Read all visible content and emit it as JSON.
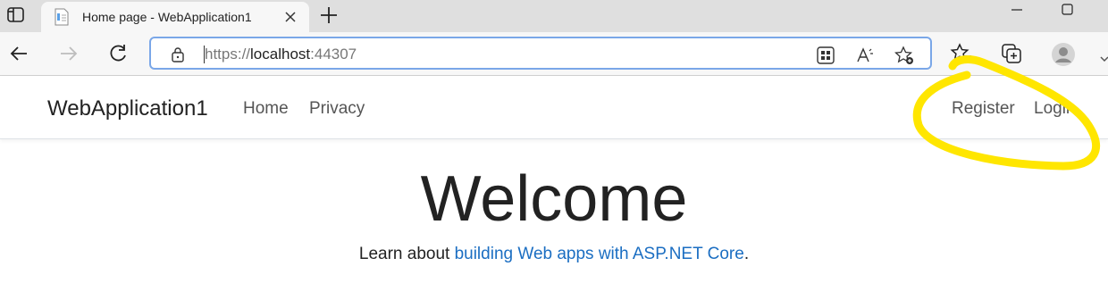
{
  "browser": {
    "tab": {
      "title": "Home page - WebApplication1"
    },
    "address_bar": {
      "scheme": "https://",
      "host": "localhost",
      "port": ":44307"
    }
  },
  "site": {
    "brand": "WebApplication1",
    "nav": {
      "home": "Home",
      "privacy": "Privacy",
      "register": "Register",
      "login": "Login"
    }
  },
  "main": {
    "heading": "Welcome",
    "learn_prefix": "Learn about ",
    "learn_link": "building Web apps with ASP.NET Core",
    "learn_suffix": "."
  },
  "colors": {
    "link": "#1b6ec2",
    "annotation": "#ffe600"
  }
}
